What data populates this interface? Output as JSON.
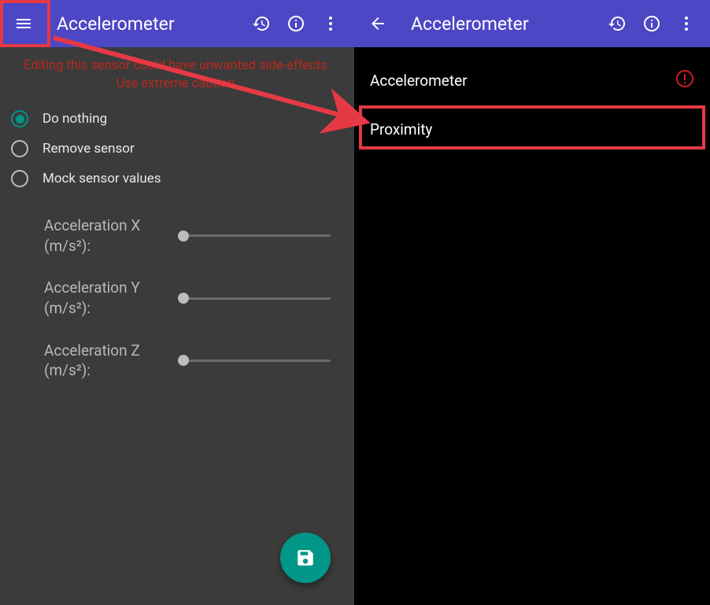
{
  "left": {
    "appbar": {
      "title": "Accelerometer"
    },
    "warning_line1": "Editing this sensor could have unwanted side-effects.",
    "warning_line2": "Use extreme caution.",
    "radios": {
      "do_nothing": "Do nothing",
      "remove_sensor": "Remove sensor",
      "mock_values": "Mock sensor values"
    },
    "sliders": {
      "accel_x": "Acceleration X (m/s²):",
      "accel_y": "Acceleration Y (m/s²):",
      "accel_z": "Acceleration Z (m/s²):"
    }
  },
  "right": {
    "appbar": {
      "title": "Accelerometer"
    },
    "items": {
      "accelerometer": "Accelerometer",
      "proximity": "Proximity"
    }
  },
  "colors": {
    "appbar": "#4c47c4",
    "accent": "#009688",
    "highlight": "#e63946",
    "warning_text": "#b9281e"
  }
}
